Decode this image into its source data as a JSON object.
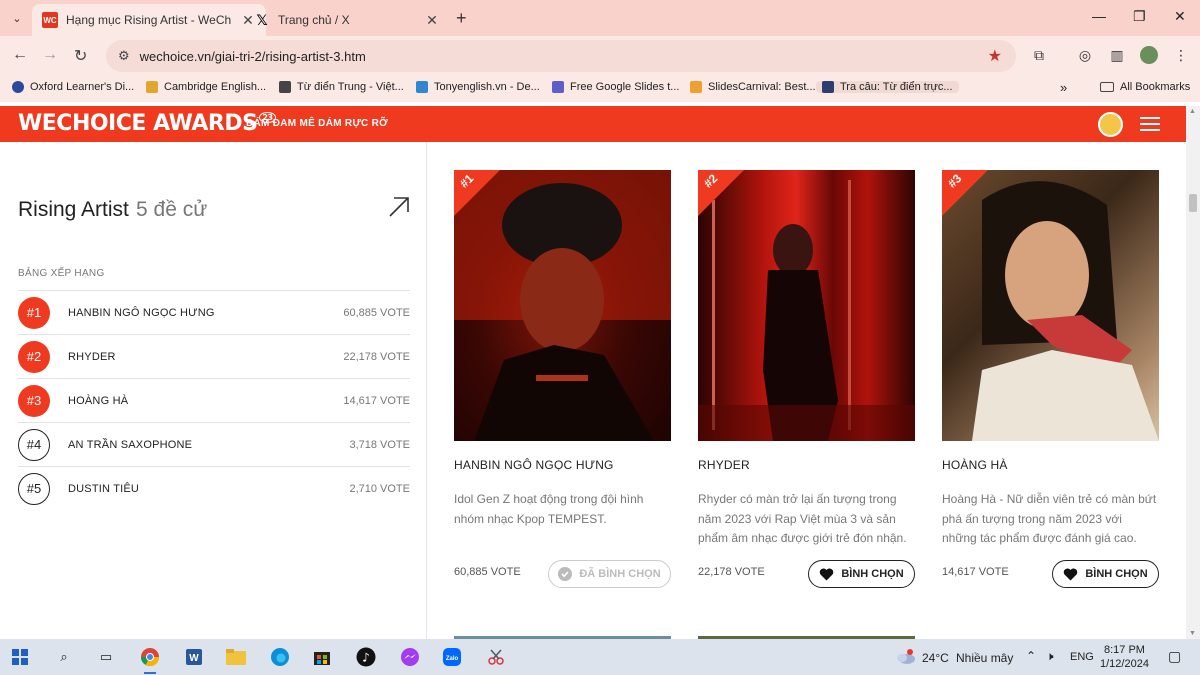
{
  "browser": {
    "tabs": [
      {
        "title": "Hạng mục Rising Artist - WeCh",
        "icon": "wechoice-favicon"
      },
      {
        "title": "Trang chủ / X",
        "icon": "x-logo-icon"
      }
    ],
    "url": "wechoice.vn/giai-tri-2/rising-artist-3.htm",
    "bookmarks": [
      {
        "label": "Oxford Learner's Di...",
        "color": "#2b4a9b"
      },
      {
        "label": "Cambridge English...",
        "color": "#e0a82e"
      },
      {
        "label": "Từ điển Trung - Việt...",
        "color": "#444444"
      },
      {
        "label": "Tonyenglish.vn - De...",
        "color": "#2f86d1"
      },
      {
        "label": "Free Google Slides t...",
        "color": "#5b5fc7"
      },
      {
        "label": "SlidesCarnival: Best...",
        "color": "#f0a030"
      },
      {
        "label": "Tra câu: Từ điển trực...",
        "color": "#2c3e70"
      }
    ],
    "bookmarks_all": "All Bookmarks"
  },
  "site": {
    "logo": "WECHOICE AWARDS",
    "logo_badge": "23",
    "tagline": "DÁM ĐAM MÊ DÁM RỰC RỠ",
    "brand_color": "#ef3a1f"
  },
  "category": {
    "title": "Rising Artist",
    "count": "5 đề cử",
    "ranking_heading": "BẢNG XẾP HẠNG"
  },
  "ranking": [
    {
      "rank": "#1",
      "name": "HANBIN NGÔ NGỌC HƯNG",
      "votes": "60,885 VOTE"
    },
    {
      "rank": "#2",
      "name": "RHYDER",
      "votes": "22,178 VOTE"
    },
    {
      "rank": "#3",
      "name": "HOÀNG HÀ",
      "votes": "14,617 VOTE"
    },
    {
      "rank": "#4",
      "name": "AN TRẦN SAXOPHONE",
      "votes": "3,718 VOTE"
    },
    {
      "rank": "#5",
      "name": "DUSTIN TIÊU",
      "votes": "2,710 VOTE"
    }
  ],
  "cards": [
    {
      "rank": "#1",
      "name": "HANBIN NGÔ NGỌC HƯNG",
      "description": "Idol Gen Z hoạt động trong đội hình nhóm nhạc Kpop TEMPEST.",
      "votes": "60,885 VOTE",
      "button": "ĐÃ BÌNH CHỌN"
    },
    {
      "rank": "#2",
      "name": "RHYDER",
      "description": "Rhyder có màn trở lại ấn tượng trong năm 2023 với Rap Việt mùa 3 và sản phẩm âm nhạc được giới trẻ đón nhận.",
      "votes": "22,178 VOTE",
      "button": "BÌNH CHỌN"
    },
    {
      "rank": "#3",
      "name": "HOÀNG HÀ",
      "description": "Hoàng Hà - Nữ diễn viên trẻ có màn bứt phá ấn tượng trong năm 2023 với những tác phẩm được đánh giá cao.",
      "votes": "14,617 VOTE",
      "button": "BÌNH CHỌN"
    }
  ],
  "taskbar": {
    "weather": "24°C",
    "weather_desc": "Nhiều mây",
    "lang": "ENG",
    "time": "8:17 PM",
    "date": "1/12/2024"
  }
}
